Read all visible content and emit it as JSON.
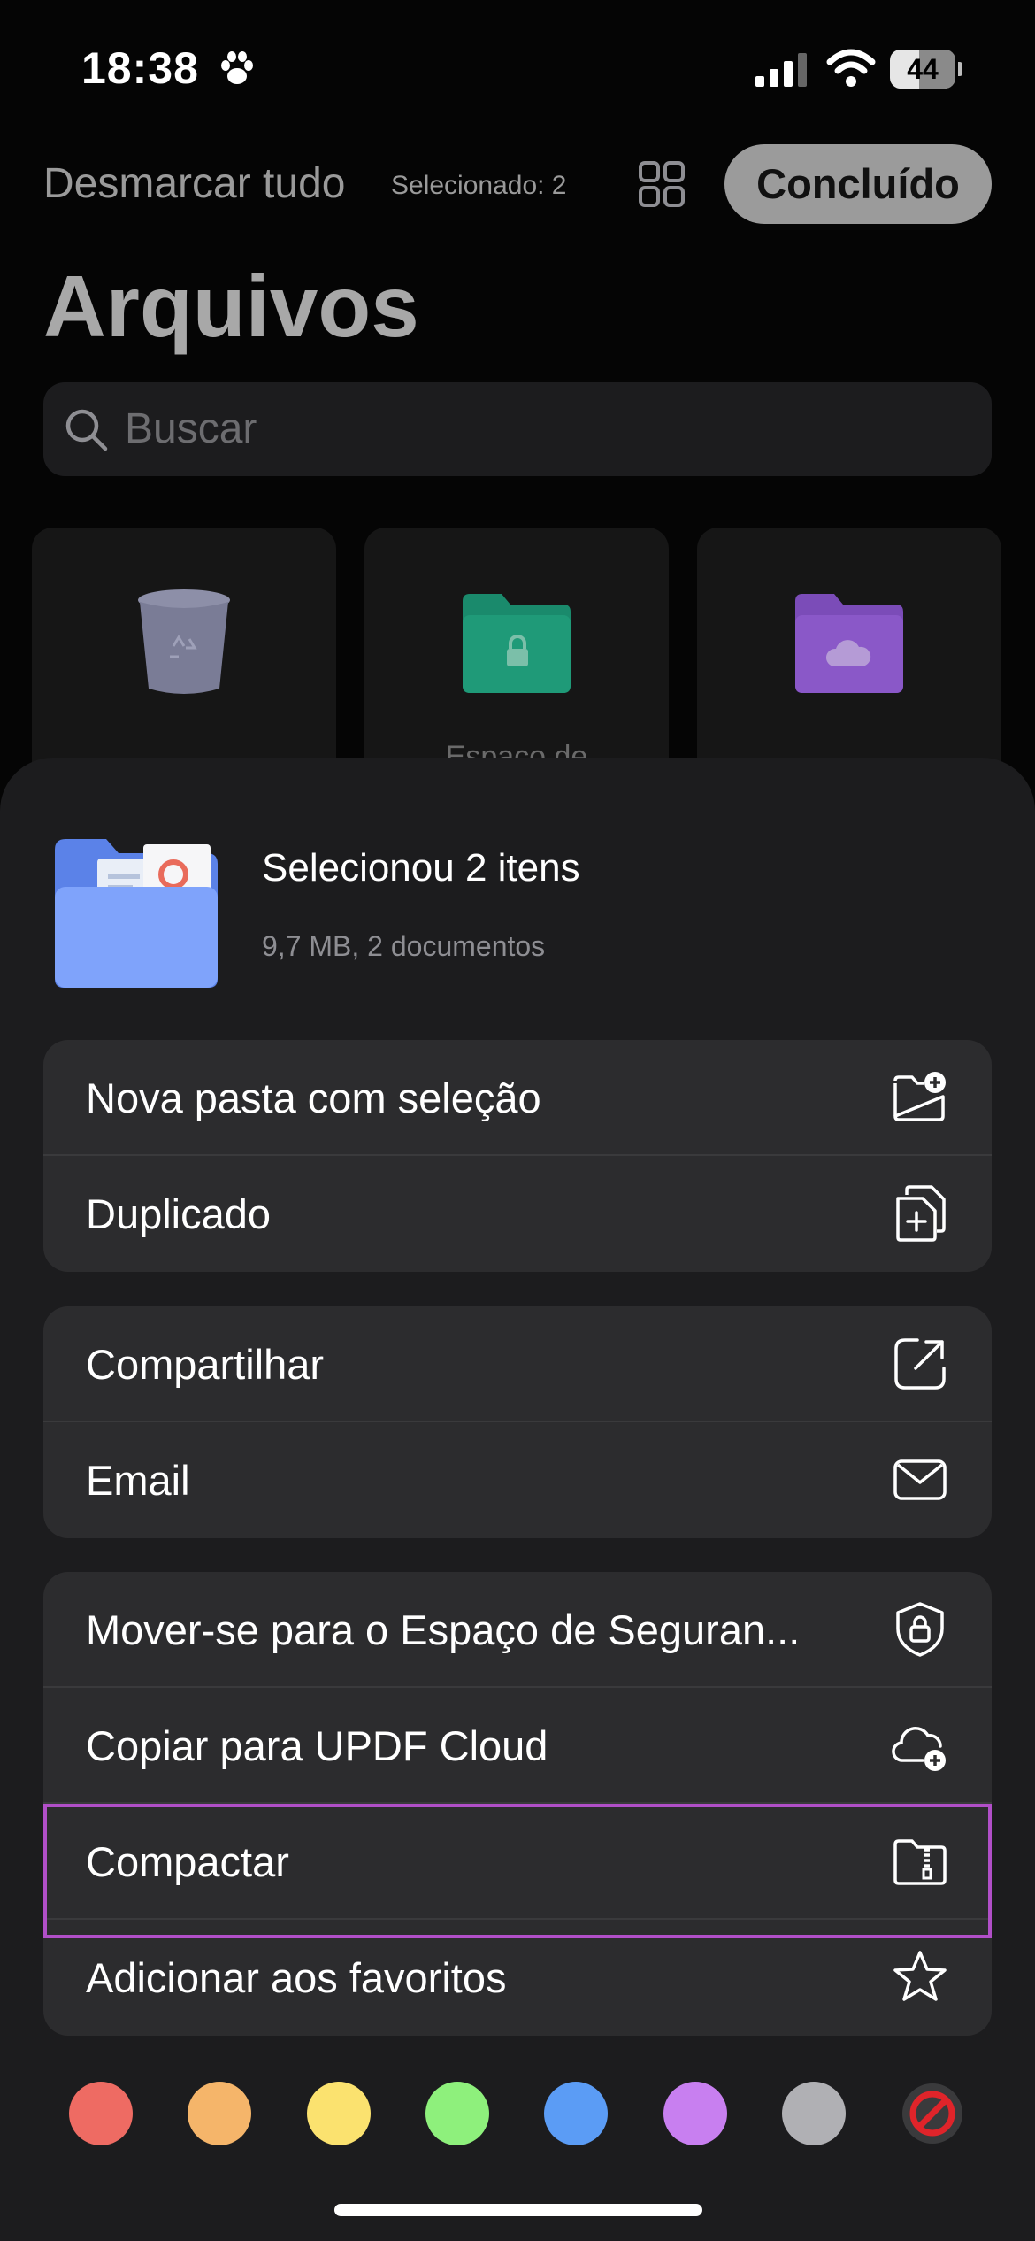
{
  "status_bar": {
    "time": "18:38",
    "battery": "44",
    "battery_level_fraction": 0.44
  },
  "header": {
    "deselect_label": "Desmarcar tudo",
    "selected_label": "Selecionado: 2",
    "done_label": "Concluído",
    "page_title": "Arquivos"
  },
  "search": {
    "placeholder": "Buscar"
  },
  "cards": [
    {
      "icon": "trash-icon",
      "label": ""
    },
    {
      "icon": "locked-folder-icon",
      "label": "Espaço de"
    },
    {
      "icon": "cloud-folder-icon",
      "label": ""
    }
  ],
  "sheet": {
    "title": "Selecionou 2 itens",
    "subtitle": "9,7 MB, 2 documentos",
    "groups": [
      [
        {
          "label": "Nova pasta com seleção",
          "icon": "new-folder-icon"
        },
        {
          "label": "Duplicado",
          "icon": "duplicate-icon"
        }
      ],
      [
        {
          "label": "Compartilhar",
          "icon": "share-icon"
        },
        {
          "label": "Email",
          "icon": "envelope-icon"
        }
      ],
      [
        {
          "label": "Mover-se para o Espaço de Seguran...",
          "icon": "shield-lock-icon"
        },
        {
          "label": "Copiar para UPDF Cloud",
          "icon": "cloud-add-icon"
        },
        {
          "label": "Compactar",
          "icon": "zip-folder-icon"
        },
        {
          "label": "Adicionar aos favoritos",
          "icon": "star-icon"
        }
      ]
    ]
  },
  "tag_colors": [
    "#ee6b63",
    "#f5b56a",
    "#fbe26f",
    "#8ef07c",
    "#5b9cf5",
    "#c87ff0",
    "#b0b0b4"
  ],
  "colors": {
    "highlight": "#b14fc8",
    "no_color": "#e0242a"
  }
}
